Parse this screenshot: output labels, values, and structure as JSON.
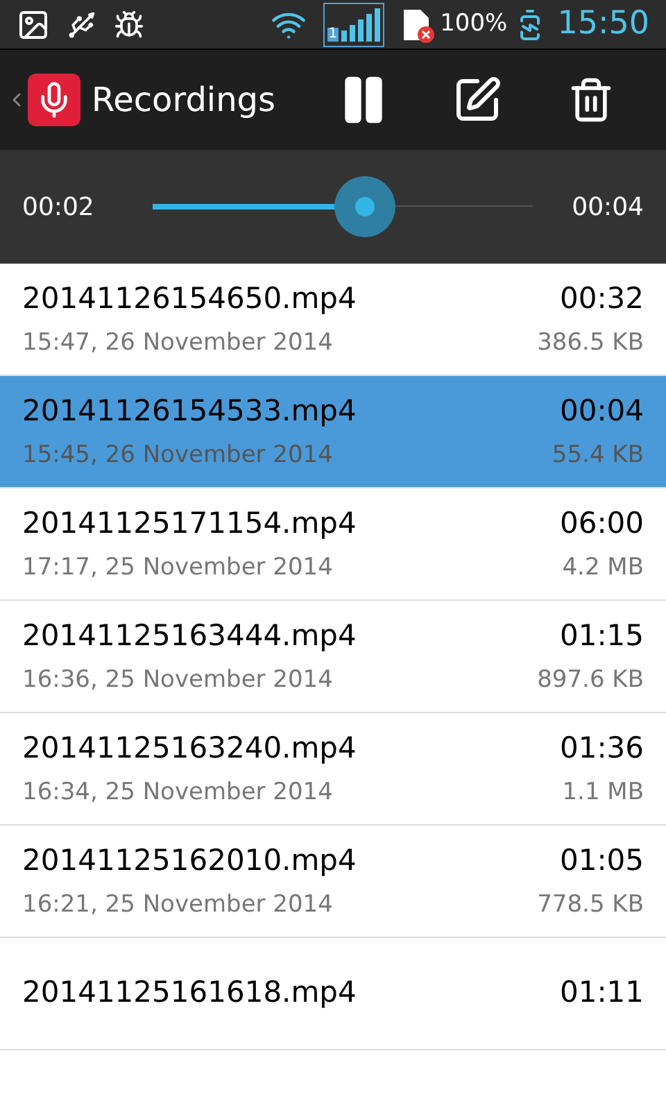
{
  "status_bar": {
    "battery": "100%",
    "time": "15:50",
    "signal_sim": "1"
  },
  "toolbar": {
    "title": "Recordings"
  },
  "player": {
    "elapsed": "00:02",
    "total": "00:04",
    "level": 0.56
  },
  "recordings": [
    {
      "name": "20141126154650.mp4",
      "duration": "00:32",
      "date": "15:47, 26 November 2014",
      "size": "386.5 KB",
      "selected": false
    },
    {
      "name": "20141126154533.mp4",
      "duration": "00:04",
      "date": "15:45, 26 November 2014",
      "size": "55.4 KB",
      "selected": true
    },
    {
      "name": "20141125171154.mp4",
      "duration": "06:00",
      "date": "17:17, 25 November 2014",
      "size": "4.2 MB",
      "selected": false
    },
    {
      "name": "20141125163444.mp4",
      "duration": "01:15",
      "date": "16:36, 25 November 2014",
      "size": "897.6 KB",
      "selected": false
    },
    {
      "name": "20141125163240.mp4",
      "duration": "01:36",
      "date": "16:34, 25 November 2014",
      "size": "1.1 MB",
      "selected": false
    },
    {
      "name": "20141125162010.mp4",
      "duration": "01:05",
      "date": "16:21, 25 November 2014",
      "size": "778.5 KB",
      "selected": false
    },
    {
      "name": "20141125161618.mp4",
      "duration": "01:11",
      "selected": false
    }
  ]
}
